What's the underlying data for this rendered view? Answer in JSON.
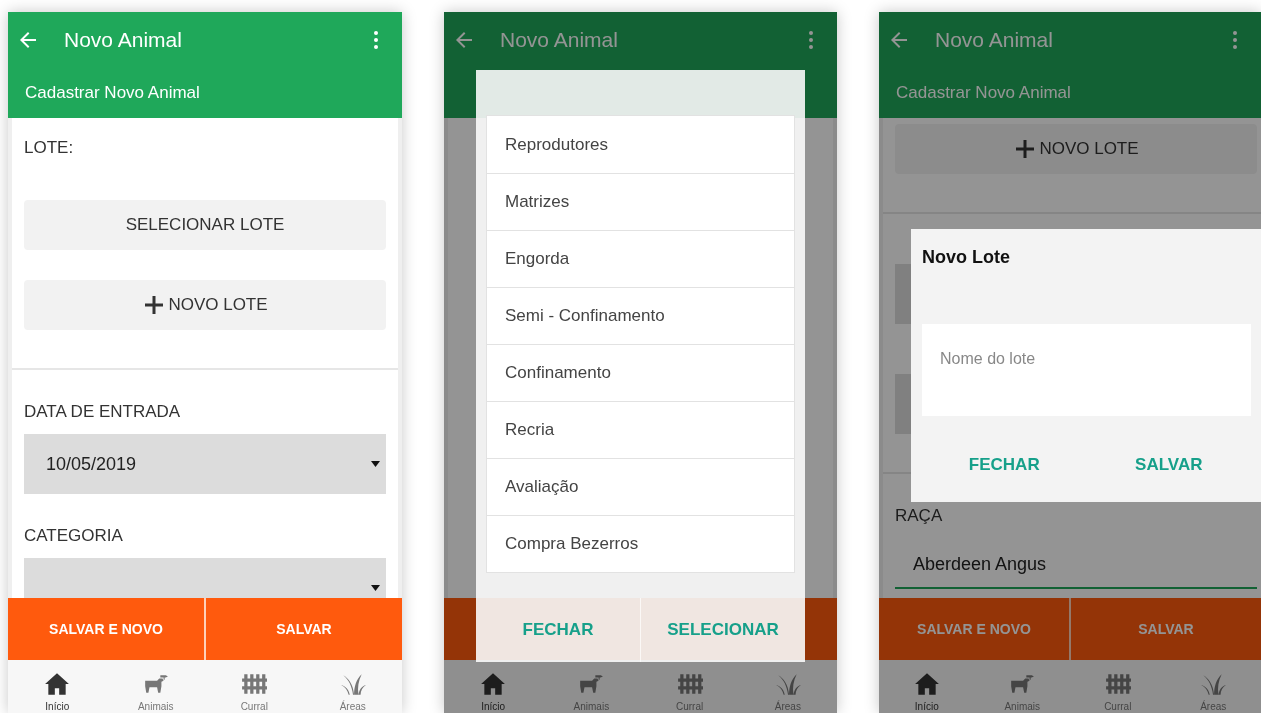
{
  "screens": [
    {
      "title": "Novo Animal",
      "subtitle": "Cadastrar Novo Animal",
      "dimmed": false,
      "form": [
        {
          "kind": "label",
          "text": "LOTE:"
        },
        {
          "kind": "button",
          "text": "SELECIONAR LOTE"
        },
        {
          "kind": "add_button",
          "text": "NOVO LOTE"
        },
        {
          "kind": "divider"
        },
        {
          "kind": "label",
          "text": "DATA DE ENTRADA"
        },
        {
          "kind": "select",
          "value": "10/05/2019"
        },
        {
          "kind": "label",
          "text": "CATEGORIA"
        },
        {
          "kind": "select"
        }
      ],
      "actions": [
        "SALVAR E NOVO",
        "SALVAR"
      ],
      "nav": [
        {
          "label": "Início",
          "selected": true
        },
        {
          "label": "Animais",
          "selected": false
        },
        {
          "label": "Curral",
          "selected": false
        },
        {
          "label": "Áreas",
          "selected": false
        }
      ]
    },
    {
      "title": "Novo Animal",
      "dimmed": true,
      "nav": [
        {
          "label": "Início",
          "selected": true
        },
        {
          "label": "Animais",
          "selected": false
        },
        {
          "label": "Curral",
          "selected": false
        },
        {
          "label": "Áreas",
          "selected": false
        }
      ],
      "dialog": {
        "kind": "list",
        "options": [
          "Reprodutores",
          "Matrizes",
          "Engorda",
          "Semi - Confinamento",
          "Confinamento",
          "Recria",
          "Avaliação",
          "Compra Bezerros"
        ],
        "buttons": [
          "FECHAR",
          "SELECIONAR"
        ]
      }
    },
    {
      "title": "Novo Animal",
      "subtitle": "Cadastrar Novo Animal",
      "dimmed": true,
      "form": [
        {
          "kind": "add_button",
          "text": "NOVO LOTE"
        },
        {
          "kind": "divider"
        },
        {
          "kind": "hidden_select"
        },
        {
          "kind": "hidden_select"
        },
        {
          "kind": "divider"
        },
        {
          "kind": "label",
          "text": "RAÇA"
        },
        {
          "kind": "text_input",
          "value": "Aberdeen Angus"
        }
      ],
      "actions": [
        "SALVAR E NOVO",
        "SALVAR"
      ],
      "nav": [
        {
          "label": "Início",
          "selected": true
        },
        {
          "label": "Animais",
          "selected": false
        },
        {
          "label": "Curral",
          "selected": false
        },
        {
          "label": "Áreas",
          "selected": false
        }
      ],
      "dialog": {
        "kind": "prompt",
        "title": "Novo Lote",
        "placeholder": "Nome do lote",
        "buttons": [
          "FECHAR",
          "SALVAR"
        ]
      }
    }
  ]
}
